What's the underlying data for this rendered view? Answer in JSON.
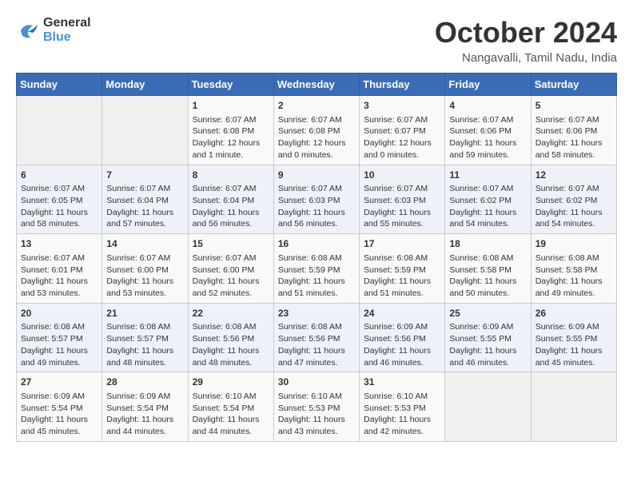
{
  "header": {
    "logo_line1": "General",
    "logo_line2": "Blue",
    "month_title": "October 2024",
    "location": "Nangavalli, Tamil Nadu, India"
  },
  "days_of_week": [
    "Sunday",
    "Monday",
    "Tuesday",
    "Wednesday",
    "Thursday",
    "Friday",
    "Saturday"
  ],
  "weeks": [
    [
      {
        "day": "",
        "content": ""
      },
      {
        "day": "",
        "content": ""
      },
      {
        "day": "1",
        "content": "Sunrise: 6:07 AM\nSunset: 6:08 PM\nDaylight: 12 hours\nand 1 minute."
      },
      {
        "day": "2",
        "content": "Sunrise: 6:07 AM\nSunset: 6:08 PM\nDaylight: 12 hours\nand 0 minutes."
      },
      {
        "day": "3",
        "content": "Sunrise: 6:07 AM\nSunset: 6:07 PM\nDaylight: 12 hours\nand 0 minutes."
      },
      {
        "day": "4",
        "content": "Sunrise: 6:07 AM\nSunset: 6:06 PM\nDaylight: 11 hours\nand 59 minutes."
      },
      {
        "day": "5",
        "content": "Sunrise: 6:07 AM\nSunset: 6:06 PM\nDaylight: 11 hours\nand 58 minutes."
      }
    ],
    [
      {
        "day": "6",
        "content": "Sunrise: 6:07 AM\nSunset: 6:05 PM\nDaylight: 11 hours\nand 58 minutes."
      },
      {
        "day": "7",
        "content": "Sunrise: 6:07 AM\nSunset: 6:04 PM\nDaylight: 11 hours\nand 57 minutes."
      },
      {
        "day": "8",
        "content": "Sunrise: 6:07 AM\nSunset: 6:04 PM\nDaylight: 11 hours\nand 56 minutes."
      },
      {
        "day": "9",
        "content": "Sunrise: 6:07 AM\nSunset: 6:03 PM\nDaylight: 11 hours\nand 56 minutes."
      },
      {
        "day": "10",
        "content": "Sunrise: 6:07 AM\nSunset: 6:03 PM\nDaylight: 11 hours\nand 55 minutes."
      },
      {
        "day": "11",
        "content": "Sunrise: 6:07 AM\nSunset: 6:02 PM\nDaylight: 11 hours\nand 54 minutes."
      },
      {
        "day": "12",
        "content": "Sunrise: 6:07 AM\nSunset: 6:02 PM\nDaylight: 11 hours\nand 54 minutes."
      }
    ],
    [
      {
        "day": "13",
        "content": "Sunrise: 6:07 AM\nSunset: 6:01 PM\nDaylight: 11 hours\nand 53 minutes."
      },
      {
        "day": "14",
        "content": "Sunrise: 6:07 AM\nSunset: 6:00 PM\nDaylight: 11 hours\nand 53 minutes."
      },
      {
        "day": "15",
        "content": "Sunrise: 6:07 AM\nSunset: 6:00 PM\nDaylight: 11 hours\nand 52 minutes."
      },
      {
        "day": "16",
        "content": "Sunrise: 6:08 AM\nSunset: 5:59 PM\nDaylight: 11 hours\nand 51 minutes."
      },
      {
        "day": "17",
        "content": "Sunrise: 6:08 AM\nSunset: 5:59 PM\nDaylight: 11 hours\nand 51 minutes."
      },
      {
        "day": "18",
        "content": "Sunrise: 6:08 AM\nSunset: 5:58 PM\nDaylight: 11 hours\nand 50 minutes."
      },
      {
        "day": "19",
        "content": "Sunrise: 6:08 AM\nSunset: 5:58 PM\nDaylight: 11 hours\nand 49 minutes."
      }
    ],
    [
      {
        "day": "20",
        "content": "Sunrise: 6:08 AM\nSunset: 5:57 PM\nDaylight: 11 hours\nand 49 minutes."
      },
      {
        "day": "21",
        "content": "Sunrise: 6:08 AM\nSunset: 5:57 PM\nDaylight: 11 hours\nand 48 minutes."
      },
      {
        "day": "22",
        "content": "Sunrise: 6:08 AM\nSunset: 5:56 PM\nDaylight: 11 hours\nand 48 minutes."
      },
      {
        "day": "23",
        "content": "Sunrise: 6:08 AM\nSunset: 5:56 PM\nDaylight: 11 hours\nand 47 minutes."
      },
      {
        "day": "24",
        "content": "Sunrise: 6:09 AM\nSunset: 5:56 PM\nDaylight: 11 hours\nand 46 minutes."
      },
      {
        "day": "25",
        "content": "Sunrise: 6:09 AM\nSunset: 5:55 PM\nDaylight: 11 hours\nand 46 minutes."
      },
      {
        "day": "26",
        "content": "Sunrise: 6:09 AM\nSunset: 5:55 PM\nDaylight: 11 hours\nand 45 minutes."
      }
    ],
    [
      {
        "day": "27",
        "content": "Sunrise: 6:09 AM\nSunset: 5:54 PM\nDaylight: 11 hours\nand 45 minutes."
      },
      {
        "day": "28",
        "content": "Sunrise: 6:09 AM\nSunset: 5:54 PM\nDaylight: 11 hours\nand 44 minutes."
      },
      {
        "day": "29",
        "content": "Sunrise: 6:10 AM\nSunset: 5:54 PM\nDaylight: 11 hours\nand 44 minutes."
      },
      {
        "day": "30",
        "content": "Sunrise: 6:10 AM\nSunset: 5:53 PM\nDaylight: 11 hours\nand 43 minutes."
      },
      {
        "day": "31",
        "content": "Sunrise: 6:10 AM\nSunset: 5:53 PM\nDaylight: 11 hours\nand 42 minutes."
      },
      {
        "day": "",
        "content": ""
      },
      {
        "day": "",
        "content": ""
      }
    ]
  ]
}
